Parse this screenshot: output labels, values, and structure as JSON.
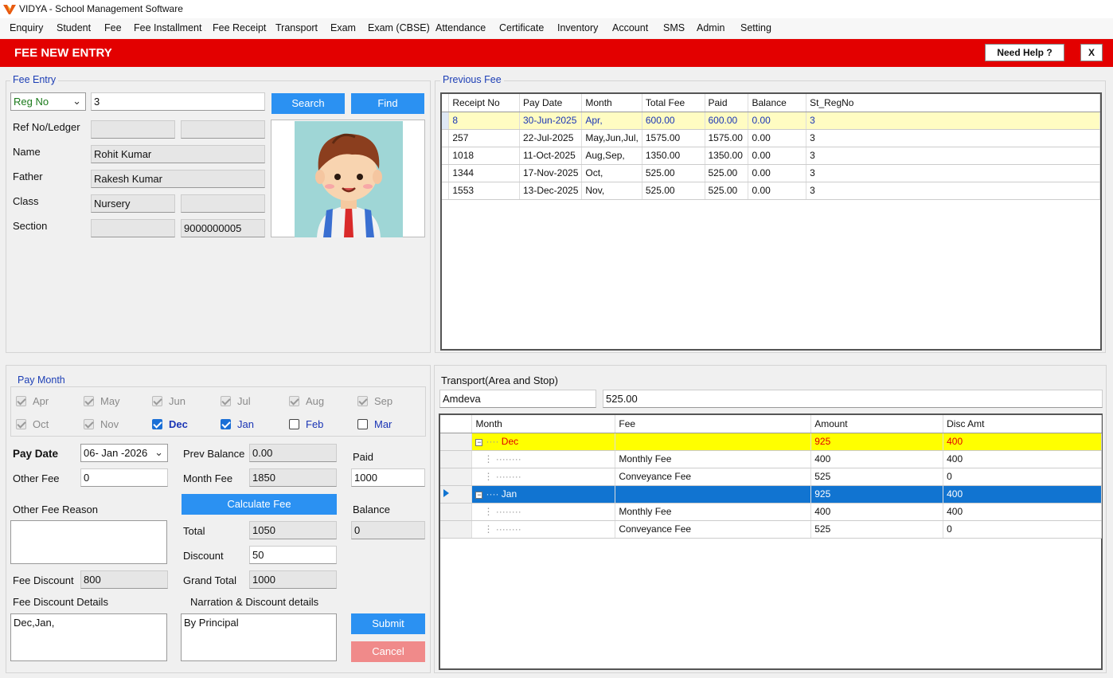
{
  "window": {
    "title": "VIDYA - School Management Software"
  },
  "menu": [
    "Enquiry",
    "Student",
    "Fee",
    "Fee Installment",
    "Fee Receipt",
    "Transport",
    "Exam",
    "Exam (CBSE)",
    "Attendance",
    "Certificate",
    "Inventory",
    "Account",
    "SMS",
    "Admin",
    "Setting"
  ],
  "header": {
    "title": "FEE NEW ENTRY",
    "help": "Need Help ?",
    "close": "X"
  },
  "fee_entry": {
    "legend": "Fee Entry",
    "search_by": "Reg No",
    "search_value": "3",
    "search_btn": "Search",
    "find_btn": "Find",
    "ref_label": "Ref No/Ledger",
    "ref1": "",
    "ref2": "",
    "name_label": "Name",
    "name": "Rohit Kumar",
    "father_label": "Father",
    "father": "Rakesh Kumar",
    "class_label": "Class",
    "class": "Nursery",
    "class2": "",
    "section_label": "Section",
    "section": "",
    "phone": "9000000005"
  },
  "previous_fee": {
    "legend": "Previous Fee",
    "columns": [
      "Receipt No",
      "Pay Date",
      "Month",
      "Total Fee",
      "Paid",
      "Balance",
      "St_RegNo"
    ],
    "rows": [
      [
        "8",
        "30-Jun-2025",
        "Apr,",
        "600.00",
        "600.00",
        "0.00",
        "3"
      ],
      [
        "257",
        "22-Jul-2025",
        "May,Jun,Jul,",
        "1575.00",
        "1575.00",
        "0.00",
        "3"
      ],
      [
        "1018",
        "11-Oct-2025",
        "Aug,Sep,",
        "1350.00",
        "1350.00",
        "0.00",
        "3"
      ],
      [
        "1344",
        "17-Nov-2025",
        "Oct,",
        "525.00",
        "525.00",
        "0.00",
        "3"
      ],
      [
        "1553",
        "13-Dec-2025",
        "Nov,",
        "525.00",
        "525.00",
        "0.00",
        "3"
      ]
    ]
  },
  "pay_month": {
    "legend": "Pay Month",
    "months": [
      {
        "label": "Apr",
        "state": "disabled"
      },
      {
        "label": "May",
        "state": "disabled"
      },
      {
        "label": "Jun",
        "state": "disabled"
      },
      {
        "label": "Jul",
        "state": "disabled"
      },
      {
        "label": "Aug",
        "state": "disabled"
      },
      {
        "label": "Sep",
        "state": "disabled"
      },
      {
        "label": "Oct",
        "state": "disabled"
      },
      {
        "label": "Nov",
        "state": "disabled"
      },
      {
        "label": "Dec",
        "state": "checked"
      },
      {
        "label": "Jan",
        "state": "checked"
      },
      {
        "label": "Feb",
        "state": "unchecked"
      },
      {
        "label": "Mar",
        "state": "unchecked"
      }
    ]
  },
  "payment": {
    "pay_date_label": "Pay Date",
    "pay_date": "06- Jan -2026",
    "other_fee_label": "Other Fee",
    "other_fee": "0",
    "prev_balance_label": "Prev Balance",
    "prev_balance": "0.00",
    "month_fee_label": "Month Fee",
    "month_fee": "1850",
    "paid_label": "Paid",
    "paid": "1000",
    "calculate_btn": "Calculate Fee",
    "other_fee_reason_label": "Other Fee Reason",
    "balance_label": "Balance",
    "balance": "0",
    "total_label": "Total",
    "total": "1050",
    "discount_label": "Discount",
    "discount": "50",
    "fee_discount_label": "Fee Discount",
    "fee_discount": "800",
    "grand_total_label": "Grand Total",
    "grand_total": "1000",
    "fee_discount_details_label": "Fee Discount Details",
    "fee_discount_details": "Dec,Jan,",
    "narration_label": "Narration & Discount  details",
    "narration": "By Principal",
    "submit_btn": "Submit",
    "cancel_btn": "Cancel"
  },
  "transport": {
    "label": "Transport(Area and Stop)",
    "area": "Amdeva",
    "amount": "525.00",
    "columns": [
      "Month",
      "Fee",
      "Amount",
      "Disc Amt"
    ],
    "rows": [
      {
        "month": "Dec",
        "fee": "",
        "amount": "925",
        "disc": "400",
        "style": "yellow",
        "node": true
      },
      {
        "month": "",
        "fee": "Monthly Fee",
        "amount": "400",
        "disc": "400",
        "style": "child"
      },
      {
        "month": "",
        "fee": "Conveyance Fee",
        "amount": "525",
        "disc": "0",
        "style": "child"
      },
      {
        "month": "Jan",
        "fee": "",
        "amount": "925",
        "disc": "400",
        "style": "blue",
        "node": true
      },
      {
        "month": "",
        "fee": "Monthly Fee",
        "amount": "400",
        "disc": "400",
        "style": "child"
      },
      {
        "month": "",
        "fee": "Conveyance Fee",
        "amount": "525",
        "disc": "0",
        "style": "child"
      }
    ]
  },
  "colors": {
    "header_red": "#e30000",
    "accent_blue": "#2b91f2",
    "selection_blue": "#1174d1",
    "highlight_yellow": "#ffff00"
  }
}
